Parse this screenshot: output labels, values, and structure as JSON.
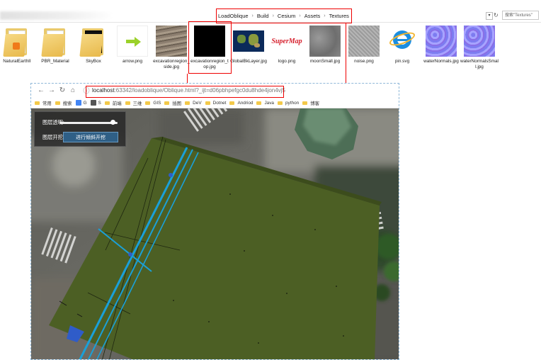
{
  "explorer": {
    "breadcrumb": [
      "LoadOblique",
      "Build",
      "Cesium",
      "Assets",
      "Textures"
    ],
    "search_placeholder": "搜索\"Textures\"",
    "files": [
      {
        "name": "NaturalEarthII",
        "kind": "folder-rss"
      },
      {
        "name": "PBR_Material",
        "kind": "folder"
      },
      {
        "name": "SkyBox",
        "kind": "folder-dark"
      },
      {
        "name": "arrow.png",
        "kind": "arrow"
      },
      {
        "name": "excavationregion_side.jpg",
        "kind": "rock"
      },
      {
        "name": "excavationregion_top.jpg",
        "kind": "black"
      },
      {
        "name": "GlobalBkLayer.jpg",
        "kind": "earth"
      },
      {
        "name": "logo.png",
        "kind": "supermap",
        "logo_text": "SuperMap"
      },
      {
        "name": "moonSmall.jpg",
        "kind": "moon"
      },
      {
        "name": "noise.png",
        "kind": "noise"
      },
      {
        "name": "pin.svg",
        "kind": "ie"
      },
      {
        "name": "waterNormals.jpg",
        "kind": "water"
      },
      {
        "name": "waterNormalsSmall.jpg",
        "kind": "water"
      }
    ]
  },
  "browser": {
    "url_host": "localhost",
    "url_path": ":63342/loadoblique/Oblique.html?_ijt=d06pbhpefgc0du8hde4jon4vj5",
    "bookmarks": [
      "常用",
      "搜索",
      "G",
      "S",
      "前端",
      "三维",
      "GIS",
      "插图",
      "DeV",
      "Dotnet",
      "Andriod",
      "Java",
      "python",
      "博客"
    ]
  },
  "panel": {
    "opacity_label": "图层透明:",
    "opacity_value": 0.92,
    "excavate_label": "图层开挖:",
    "excavate_button": "进行倾斜开挖"
  },
  "colors": {
    "accent_red": "#e00000",
    "excavation_green": "#4c5f24",
    "pipe_blue": "#1aa0d8",
    "panel_bg": "#262626"
  }
}
